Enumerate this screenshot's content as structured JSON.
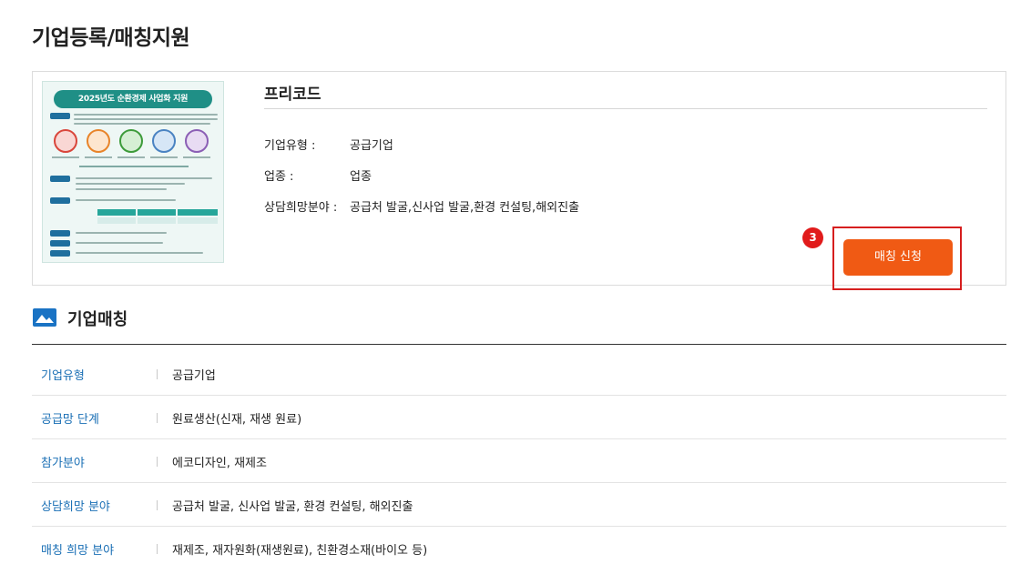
{
  "page": {
    "title": "기업등록/매칭지원"
  },
  "company": {
    "poster": {
      "banner": "2025년도 순환경제 사업화 지원"
    },
    "name": "프리코드",
    "info": [
      {
        "label": "기업유형 :",
        "value": "공급기업"
      },
      {
        "label": "업종 :",
        "value": "업종"
      },
      {
        "label": "상담희망분야 :",
        "value": "공급처 발굴,신사업 발굴,환경 컨설팅,해외진출"
      }
    ],
    "step_badge": "3",
    "match_button_label": "매칭 신청"
  },
  "matching": {
    "section_title": "기업매칭",
    "rows": [
      {
        "label": "기업유형",
        "value": "공급기업"
      },
      {
        "label": "공급망 단계",
        "value": "원료생산(신재, 재생 원료)"
      },
      {
        "label": "참가분야",
        "value": "에코디자인, 재제조"
      },
      {
        "label": "상담희망 분야",
        "value": "공급처 발굴, 신사업 발굴, 환경 컨설팅, 해외진출"
      },
      {
        "label": "매칭 희망 분야",
        "value": "재제조, 재자원화(재생원료), 친환경소재(바이오 등)"
      }
    ]
  },
  "colors": {
    "accent_button": "#f05a14",
    "highlight_border": "#d61e1e",
    "badge": "#e11b1b",
    "label_blue": "#1a6fb5",
    "section_icon": "#1a73c4",
    "poster_banner": "#1f8f86"
  }
}
